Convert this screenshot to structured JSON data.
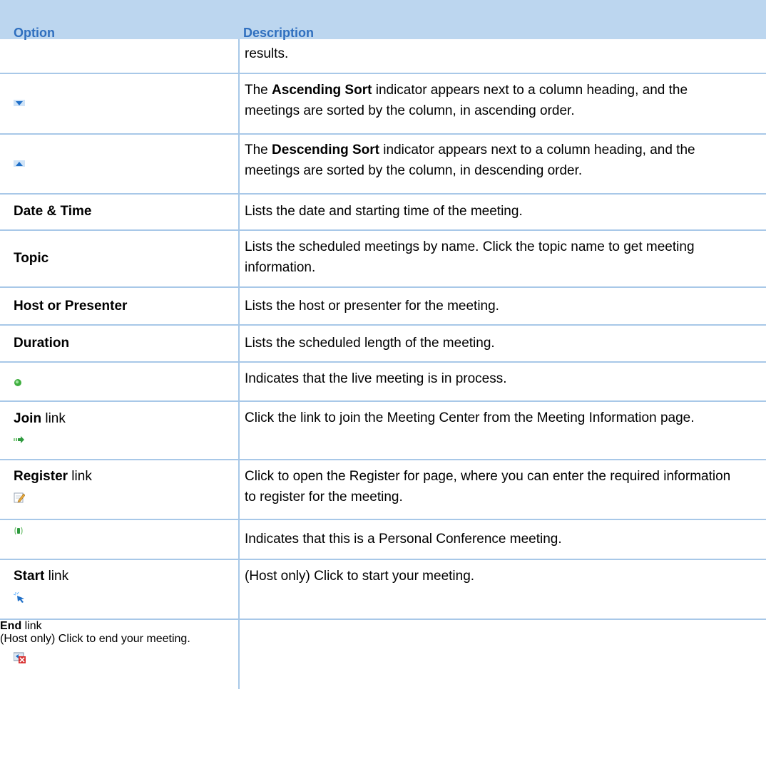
{
  "header": {
    "option": "Option",
    "description": "Description"
  },
  "continued": {
    "description": "results."
  },
  "rows": [
    {
      "option_icon": "ascending-sort-triangle-icon",
      "desc_before": "The ",
      "desc_bold": "Ascending Sort",
      "desc_after": " indicator appears next to a column heading, and the meetings are sorted by the column, in ascending order."
    },
    {
      "option_icon": "descending-sort-triangle-icon",
      "desc_before": "The ",
      "desc_bold": "Descending Sort",
      "desc_after": " indicator appears next to a column heading, and the meetings are sorted by the column, in descending order."
    },
    {
      "option": "Date & Time",
      "description": "Lists the date and starting time of the  meeting."
    },
    {
      "option": "Topic",
      "description": "Lists the scheduled meetings by name. Click the topic name to get meeting information."
    },
    {
      "option": "Host or Presenter",
      "description": "Lists the host or presenter for the meeting."
    },
    {
      "option": "Duration",
      "description": "Lists the scheduled length of the meeting."
    },
    {
      "option_icon": "live-meeting-green-dot-icon",
      "description": "Indicates that the live meeting is in process."
    },
    {
      "option_bold": "Join",
      "option_rest": " link",
      "option_icon": "join-arrow-icon",
      "description": "Click the link to join the Meeting Center from the Meeting Information page."
    },
    {
      "option_bold": "Register",
      "option_rest": " link",
      "option_icon": "register-pencil-icon",
      "description": "Click to open the Register for page, where you can enter the required information to register for the meeting."
    },
    {
      "option_icon": "personal-conference-phone-icon",
      "description": "Indicates that this is a Personal Conference meeting."
    },
    {
      "option_bold": "Start",
      "option_rest": " link",
      "option_icon": "start-cursor-icon",
      "description": "(Host only) Click to start your meeting."
    },
    {
      "option_bold": "End",
      "option_rest": " link",
      "option_icon": "end-red-x-icon",
      "description": "(Host only) Click to end your meeting."
    }
  ],
  "colors": {
    "header_bg": "#bcd6ef",
    "header_text": "#2f6fbf",
    "rule": "#a8c8e8"
  }
}
